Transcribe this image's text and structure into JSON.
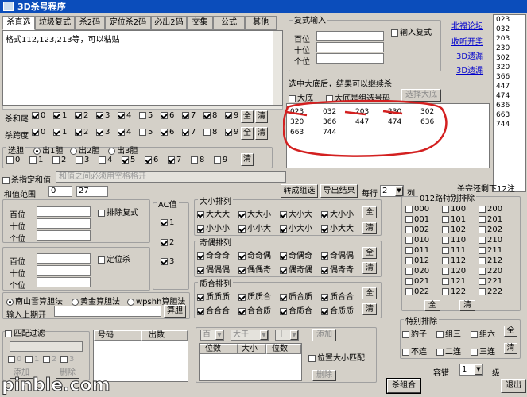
{
  "window": {
    "title": "3D杀号程序"
  },
  "tabs": [
    "杀直选",
    "垃圾复式",
    "杀2码",
    "定位杀2码",
    "必出2码",
    "交集",
    "公式",
    "其他"
  ],
  "input": {
    "text": "格式112,123,213等，可以粘贴"
  },
  "fushi": {
    "title": "复式输入",
    "pos": [
      "百位",
      "十位",
      "个位"
    ],
    "chk": "输入复式"
  },
  "links": [
    "北福论坛",
    "收听开奖",
    "3D遗漏",
    "3D遗漏"
  ],
  "right_list": [
    "023",
    "032",
    "203",
    "230",
    "302",
    "320",
    "366",
    "447",
    "474",
    "636",
    "663",
    "744"
  ],
  "select_info": "选中大底后，结果可以继续杀",
  "big_bottom": {
    "label1": "大底",
    "label2": "大底是组选号码",
    "btn": "选择大底"
  },
  "result_grid": [
    [
      "023",
      "032",
      "203",
      "230",
      "302"
    ],
    [
      "320",
      "366",
      "447",
      "474",
      "636"
    ],
    [
      "663",
      "744",
      "",
      "",
      ""
    ]
  ],
  "kill_sum": {
    "label": "杀和尾",
    "digits": [
      "0",
      "1",
      "2",
      "3",
      "4",
      "5",
      "6",
      "7",
      "8",
      "9"
    ],
    "checked": [
      1,
      1,
      1,
      1,
      1,
      0,
      1,
      1,
      1,
      1
    ],
    "btn_all": "全",
    "btn_clear": "清"
  },
  "kill_span": {
    "label": "杀跨度",
    "digits": [
      "0",
      "1",
      "2",
      "3",
      "4",
      "5",
      "6",
      "7",
      "8",
      "9"
    ],
    "checked": [
      1,
      1,
      1,
      1,
      1,
      0,
      1,
      1,
      0,
      1
    ],
    "btn_all": "全",
    "btn_clear": "清"
  },
  "choose_dan": {
    "label": "选胆",
    "opts": [
      "出1胆",
      "出2胆",
      "出3胆"
    ],
    "digits": [
      "0",
      "1",
      "2",
      "3",
      "4",
      "5",
      "6",
      "7",
      "8",
      "9"
    ],
    "checked": [
      0,
      0,
      0,
      0,
      0,
      1,
      1,
      1,
      0,
      0
    ],
    "btn_clear": "清"
  },
  "kill_value": {
    "chk": "杀指定和值",
    "placeholder": "和值之间必须用空格格开"
  },
  "sum_range": {
    "label": "和值范围",
    "from": "0",
    "to": "27"
  },
  "toolbar": {
    "convert": "转成组选",
    "export": "导出结果",
    "per_row": "每行",
    "per_row_val": "2",
    "col": "列",
    "remain": "杀完还剩下12注"
  },
  "pos_group1": {
    "labels": [
      "百位",
      "十位",
      "个位"
    ],
    "chk": "排除复式"
  },
  "pos_group2": {
    "labels": [
      "百位",
      "十位",
      "个位"
    ],
    "chk": "定位杀"
  },
  "ac": {
    "title": "AC值",
    "items": [
      "1",
      "2",
      "3"
    ]
  },
  "size_group": {
    "title": "大小排列",
    "rows": [
      [
        "大大大",
        "大大小",
        "大小大",
        "大小小"
      ],
      [
        "小小小",
        "小小大",
        "小大小",
        "小大大"
      ]
    ],
    "btn_all": "全",
    "btn_clear": "清"
  },
  "odd_group": {
    "title": "奇偶排列",
    "rows": [
      [
        "奇奇奇",
        "奇奇偶",
        "奇偶奇",
        "奇偶偶"
      ],
      [
        "偶偶偶",
        "偶偶奇",
        "偶奇偶",
        "偶奇奇"
      ]
    ],
    "btn_all": "全",
    "btn_clear": "清"
  },
  "prime_group": {
    "title": "质合排列",
    "rows": [
      [
        "质质质",
        "质质合",
        "质合质",
        "质合合"
      ],
      [
        "合合合",
        "合合质",
        "合质合",
        "合质质"
      ]
    ],
    "btn_all": "全",
    "btn_clear": "清"
  },
  "special012": {
    "title": "012路特别排除",
    "cols": [
      [
        "000",
        "001",
        "002",
        "010",
        "011",
        "012",
        "020",
        "021",
        "022"
      ],
      [
        "100",
        "101",
        "102",
        "110",
        "111",
        "112",
        "120",
        "121",
        "122"
      ],
      [
        "200",
        "201",
        "202",
        "210",
        "211",
        "212",
        "220",
        "221",
        "222"
      ]
    ],
    "btn_all": "全",
    "btn_clear": "清"
  },
  "algo": {
    "opts": [
      "南山雪算胆法",
      "黄金算胆法",
      "wpshh算胆法"
    ],
    "input_label": "输入上期开",
    "btn": "算胆"
  },
  "match": {
    "chk": "匹配过滤",
    "nums": [
      "0",
      "1",
      "2",
      "3"
    ],
    "btn_add": "添加",
    "btn_del": "删除"
  },
  "code_table": {
    "cols": [
      "号码",
      "出数"
    ]
  },
  "pos_filter": {
    "sel1": "百",
    "sel2": "大于",
    "sel3": "十",
    "btn_add": "添加",
    "cols": [
      "位数",
      "大小",
      "位数"
    ],
    "chk": "位置大小匹配",
    "btn_del": "删除"
  },
  "special": {
    "title": "特别排除",
    "items": [
      [
        "豹子",
        "组三",
        "组六"
      ],
      [
        "不连",
        "二连",
        "三连"
      ]
    ],
    "btn_all": "全",
    "btn_clear": "清"
  },
  "tolerance": {
    "label": "容错",
    "val": "1",
    "level": "级"
  },
  "bottom": {
    "kill_btn": "杀组合",
    "exit_btn": "退出"
  },
  "watermark": "pinble.com"
}
